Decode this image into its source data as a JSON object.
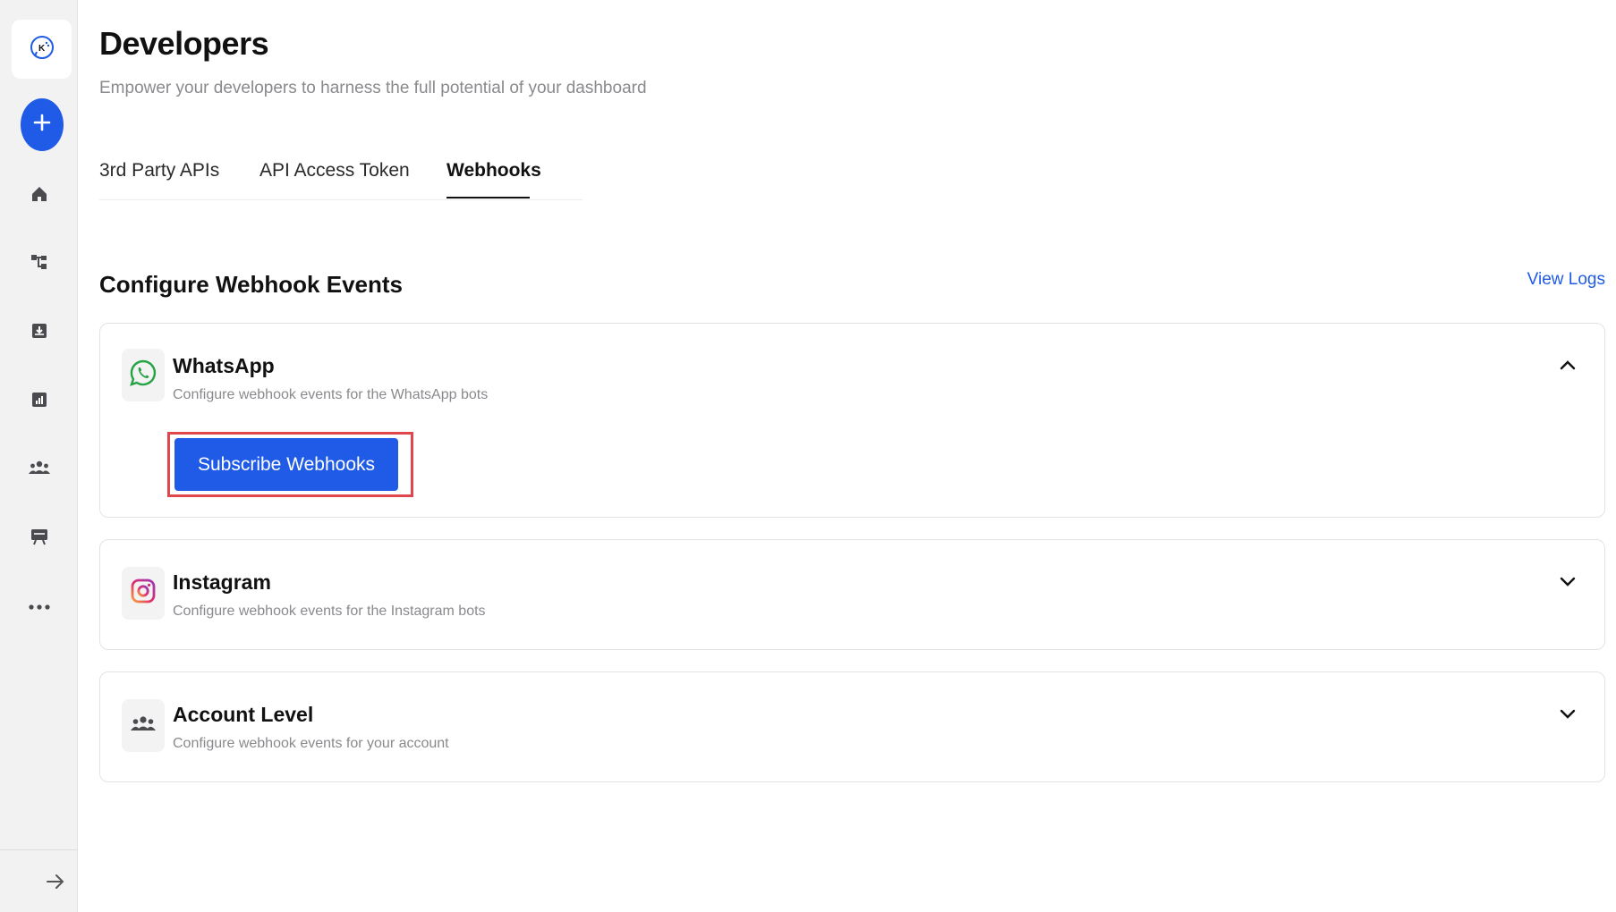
{
  "header": {
    "title": "Developers",
    "subtitle": "Empower your developers to harness the full potential of your dashboard"
  },
  "tabs": [
    {
      "label": "3rd Party APIs",
      "active": false
    },
    {
      "label": "API Access Token",
      "active": false
    },
    {
      "label": "Webhooks",
      "active": true
    }
  ],
  "section": {
    "title": "Configure Webhook Events",
    "view_logs": "View Logs"
  },
  "cards": [
    {
      "name": "WhatsApp",
      "description": "Configure webhook events for the WhatsApp bots",
      "icon": "whatsapp-icon",
      "expanded": true,
      "button_label": "Subscribe Webhooks"
    },
    {
      "name": "Instagram",
      "description": "Configure webhook events for the Instagram bots",
      "icon": "instagram-icon",
      "expanded": false
    },
    {
      "name": "Account Level",
      "description": "Configure webhook events for your account",
      "icon": "users-icon",
      "expanded": false
    }
  ],
  "sidebar": {
    "icons": [
      "logo-icon",
      "plus-icon",
      "home-icon",
      "flow-icon",
      "download-icon",
      "analytics-icon",
      "team-icon",
      "billboard-icon",
      "more-icon",
      "arrow-right-icon"
    ]
  },
  "colors": {
    "accent": "#1f5be6",
    "highlight": "#e0474c",
    "whatsapp": "#25a244",
    "sidebar_bg": "#f2f2f3"
  }
}
